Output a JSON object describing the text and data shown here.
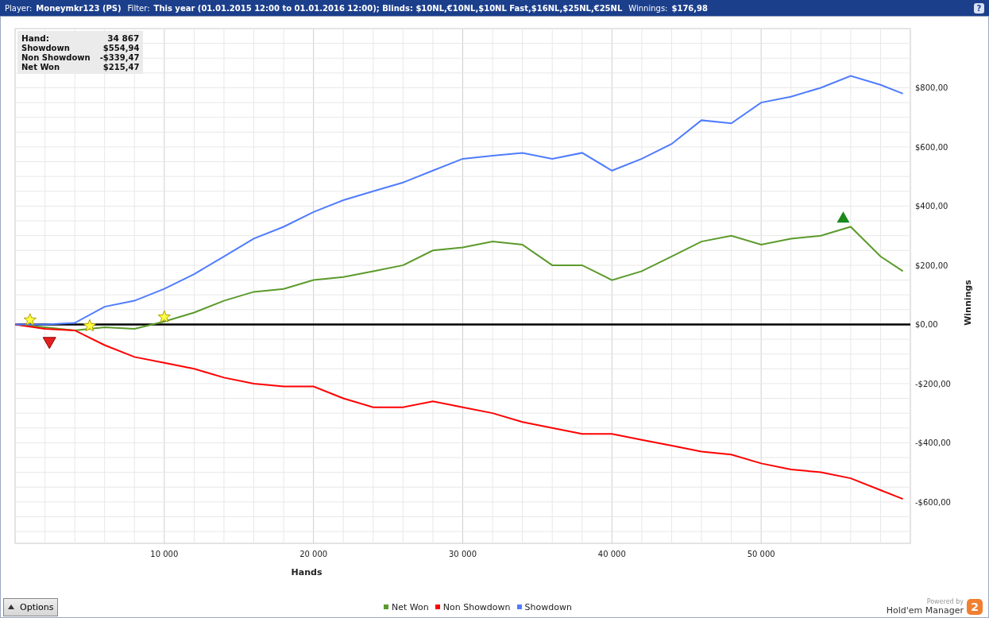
{
  "header": {
    "items": [
      {
        "label": "Player:",
        "value": "Moneymkr123 (PS)"
      },
      {
        "label": "Filter:",
        "value": "This year (01.01.2015 12:00 to 01.01.2016 12:00); Blinds: $10NL,€10NL,$10NL Fast,$16NL,$25NL,€25NL"
      },
      {
        "label": "Winnings:",
        "value": "$176,98"
      }
    ],
    "help": "?"
  },
  "stats": [
    {
      "label": "Hand:",
      "value": "34 867"
    },
    {
      "label": "Showdown",
      "value": "$554,94"
    },
    {
      "label": "Non Showdown",
      "value": "-$339,47"
    },
    {
      "label": "Net Won",
      "value": "$215,47"
    }
  ],
  "chart_data": {
    "type": "line",
    "xlabel": "Hands",
    "ylabel": "Winnings",
    "x": [
      0,
      2000,
      4000,
      6000,
      8000,
      10000,
      12000,
      14000,
      16000,
      18000,
      20000,
      22000,
      24000,
      26000,
      28000,
      30000,
      32000,
      34000,
      36000,
      38000,
      40000,
      42000,
      44000,
      46000,
      48000,
      50000,
      52000,
      54000,
      56000,
      58000,
      59500
    ],
    "series": [
      {
        "name": "Net Won",
        "color": "#5b9a2b",
        "values": [
          0,
          -10,
          -20,
          -10,
          -15,
          10,
          40,
          80,
          110,
          120,
          150,
          160,
          180,
          200,
          250,
          260,
          280,
          270,
          200,
          200,
          150,
          180,
          230,
          280,
          300,
          270,
          290,
          300,
          330,
          230,
          180
        ]
      },
      {
        "name": "Non Showdown",
        "color": "#ff0000",
        "values": [
          0,
          -15,
          -20,
          -70,
          -110,
          -130,
          -150,
          -180,
          -200,
          -210,
          -210,
          -250,
          -280,
          -280,
          -260,
          -280,
          -300,
          -330,
          -350,
          -370,
          -370,
          -390,
          -410,
          -430,
          -440,
          -470,
          -490,
          -500,
          -520,
          -560,
          -590
        ]
      },
      {
        "name": "Showdown",
        "color": "#4f7cff",
        "values": [
          0,
          0,
          5,
          60,
          80,
          120,
          170,
          230,
          290,
          330,
          380,
          420,
          450,
          480,
          520,
          560,
          570,
          580,
          560,
          580,
          520,
          560,
          610,
          690,
          680,
          750,
          770,
          800,
          840,
          810,
          780
        ]
      }
    ],
    "xlim": [
      0,
      60000
    ],
    "ylim": [
      -740,
      1000
    ],
    "xticks": [
      {
        "value": 10000,
        "label": "10 000"
      },
      {
        "value": 20000,
        "label": "20 000"
      },
      {
        "value": 30000,
        "label": "30 000"
      },
      {
        "value": 40000,
        "label": "40 000"
      },
      {
        "value": 50000,
        "label": "50 000"
      }
    ],
    "yticks": [
      {
        "value": -600,
        "label": "-$600,00"
      },
      {
        "value": -400,
        "label": "-$400,00"
      },
      {
        "value": -200,
        "label": "-$200,00"
      },
      {
        "value": 0,
        "label": "$0,00"
      },
      {
        "value": 200,
        "label": "$200,00"
      },
      {
        "value": 400,
        "label": "$400,00"
      },
      {
        "value": 600,
        "label": "$600,00"
      },
      {
        "value": 800,
        "label": "$800,00"
      }
    ],
    "grid": true
  },
  "markers": [
    {
      "kind": "star"
    },
    {
      "kind": "star"
    },
    {
      "kind": "star"
    },
    {
      "kind": "low"
    },
    {
      "kind": "high"
    }
  ],
  "options_button": {
    "label": "Options"
  },
  "brand": {
    "tagline": "Powered by",
    "name": "Hold'em Manager",
    "version": "2"
  }
}
